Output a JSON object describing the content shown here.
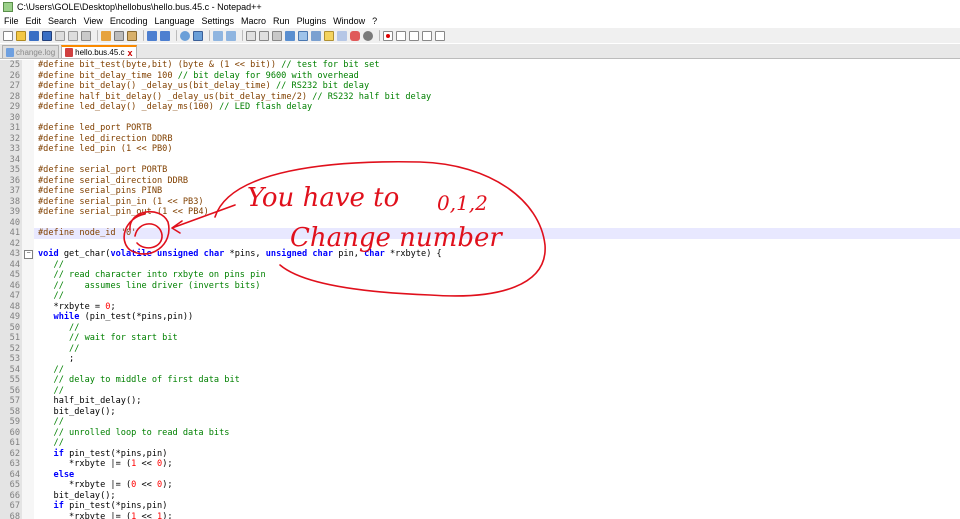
{
  "window": {
    "title": "C:\\Users\\GOLE\\Desktop\\hellobus\\hello.bus.45.c - Notepad++"
  },
  "menu": [
    "File",
    "Edit",
    "Search",
    "View",
    "Encoding",
    "Language",
    "Settings",
    "Macro",
    "Run",
    "Plugins",
    "Window",
    "?"
  ],
  "tabs": [
    {
      "label": "change.log",
      "active": false
    },
    {
      "label": "hello.bus.45.c",
      "active": true
    }
  ],
  "code_lines": [
    {
      "n": "25",
      "text": "#define bit_test(byte,bit) (byte & (1 << bit)) // test for bit set"
    },
    {
      "n": "26",
      "text": "#define bit_delay_time 100 // bit delay for 9600 with overhead"
    },
    {
      "n": "27",
      "text": "#define bit_delay() _delay_us(bit_delay_time) // RS232 bit delay"
    },
    {
      "n": "28",
      "text": "#define half_bit_delay() _delay_us(bit_delay_time/2) // RS232 half bit delay"
    },
    {
      "n": "29",
      "text": "#define led_delay() _delay_ms(100) // LED flash delay"
    },
    {
      "n": "30",
      "text": ""
    },
    {
      "n": "31",
      "text": "#define led_port PORTB"
    },
    {
      "n": "32",
      "text": "#define led_direction DDRB"
    },
    {
      "n": "33",
      "text": "#define led_pin (1 << PB0)"
    },
    {
      "n": "34",
      "text": ""
    },
    {
      "n": "35",
      "text": "#define serial_port PORTB"
    },
    {
      "n": "36",
      "text": "#define serial_direction DDRB"
    },
    {
      "n": "37",
      "text": "#define serial_pins PINB"
    },
    {
      "n": "38",
      "text": "#define serial_pin_in (1 << PB3)"
    },
    {
      "n": "39",
      "text": "#define serial_pin_out (1 << PB4)"
    },
    {
      "n": "40",
      "text": ""
    },
    {
      "n": "41",
      "text": "#define node_id '0'"
    },
    {
      "n": "42",
      "text": ""
    },
    {
      "n": "43",
      "text": "void get_char(volatile unsigned char *pins, unsigned char pin, char *rxbyte) {"
    },
    {
      "n": "44",
      "text": "   //"
    },
    {
      "n": "45",
      "text": "   // read character into rxbyte on pins pin"
    },
    {
      "n": "46",
      "text": "   //    assumes line driver (inverts bits)"
    },
    {
      "n": "47",
      "text": "   //"
    },
    {
      "n": "48",
      "text": "   *rxbyte = 0;"
    },
    {
      "n": "49",
      "text": "   while (pin_test(*pins,pin))"
    },
    {
      "n": "50",
      "text": "      //"
    },
    {
      "n": "51",
      "text": "      // wait for start bit"
    },
    {
      "n": "52",
      "text": "      //"
    },
    {
      "n": "53",
      "text": "      ;"
    },
    {
      "n": "54",
      "text": "   //"
    },
    {
      "n": "55",
      "text": "   // delay to middle of first data bit"
    },
    {
      "n": "56",
      "text": "   //"
    },
    {
      "n": "57",
      "text": "   half_bit_delay();"
    },
    {
      "n": "58",
      "text": "   bit_delay();"
    },
    {
      "n": "59",
      "text": "   //"
    },
    {
      "n": "60",
      "text": "   // unrolled loop to read data bits"
    },
    {
      "n": "61",
      "text": "   //"
    },
    {
      "n": "62",
      "text": "   if pin_test(*pins,pin)"
    },
    {
      "n": "63",
      "text": "      *rxbyte |= (1 << 0);"
    },
    {
      "n": "64",
      "text": "   else"
    },
    {
      "n": "65",
      "text": "      *rxbyte |= (0 << 0);"
    },
    {
      "n": "66",
      "text": "   bit_delay();"
    },
    {
      "n": "67",
      "text": "   if pin_test(*pins,pin)"
    },
    {
      "n": "68",
      "text": "      *rxbyte |= (1 << 1);"
    }
  ],
  "annotation": {
    "line1": "You have to",
    "line1b": "0,1,2",
    "line2": "Change number",
    "ink_color": "#e0101c"
  },
  "colors": {
    "preprocessor": "#804000",
    "comment": "#008000",
    "keyword": "#0000ff",
    "number": "#ff0000",
    "string": "#808080",
    "tab_accent": "#fa8a00"
  }
}
